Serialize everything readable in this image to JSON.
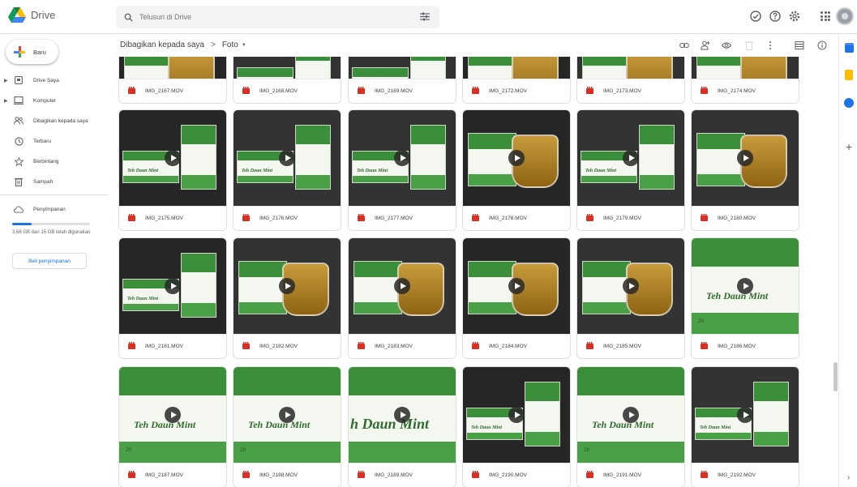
{
  "app": {
    "name": "Drive"
  },
  "search": {
    "placeholder": "Telusuri di Drive"
  },
  "sidebar": {
    "new_label": "Baru",
    "items": [
      {
        "label": "Drive Saya",
        "icon": "my-drive-icon"
      },
      {
        "label": "Komputer",
        "icon": "computer-icon"
      },
      {
        "label": "Dibagikan kepada saya",
        "icon": "shared-icon"
      },
      {
        "label": "Terbaru",
        "icon": "clock-icon"
      },
      {
        "label": "Berbintang",
        "icon": "star-icon"
      },
      {
        "label": "Sampah",
        "icon": "trash-icon"
      },
      {
        "label": "Penyimpanan",
        "icon": "cloud-icon"
      }
    ],
    "storage_text": "3,68 GB dari 15 GB telah digunakan",
    "storage_fraction": 0.245,
    "buy_label": "Beli penyimpanan"
  },
  "breadcrumb": {
    "parent": "Dibagikan kepada saya",
    "current": "Foto"
  },
  "files": [
    "IMG_2167.MOV",
    "IMG_2168.MOV",
    "IMG_2169.MOV",
    "IMG_2172.MOV",
    "IMG_2173.MOV",
    "IMG_2174.MOV",
    "IMG_2175.MOV",
    "IMG_2176.MOV",
    "IMG_2177.MOV",
    "IMG_2178.MOV",
    "IMG_2179.MOV",
    "IMG_2180.MOV",
    "IMG_2181.MOV",
    "IMG_2182.MOV",
    "IMG_2183.MOV",
    "IMG_2184.MOV",
    "IMG_2185.MOV",
    "IMG_2186.MOV",
    "IMG_2187.MOV",
    "IMG_2188.MOV",
    "IMG_2189.MOV",
    "IMG_2190.MOV",
    "IMG_2191.MOV",
    "IMG_2192.MOV"
  ],
  "thumb_texts": {
    "box_title": "Teh Daun Mint",
    "box_title_partial": "h Daun Mint",
    "box_number": "20"
  },
  "colors": {
    "accent": "#1a73e8",
    "video": "#d93025",
    "leaf": "#3c8f3a"
  }
}
